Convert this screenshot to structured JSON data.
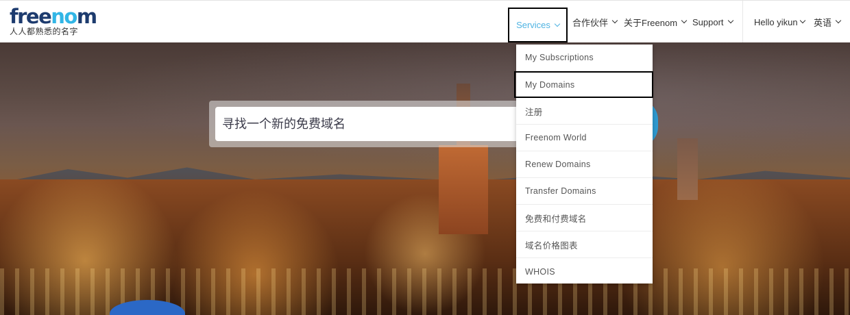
{
  "logo": {
    "brand_fre": "free",
    "brand_no": "no",
    "brand_m": "m",
    "tagline": "人人都熟悉的名字"
  },
  "nav": {
    "services": "Services",
    "partners": "合作伙伴",
    "about": "关于Freenom",
    "support": "Support",
    "user": "Hello yikun",
    "language": "英语"
  },
  "search": {
    "placeholder": "寻找一个新的免费域名"
  },
  "services_menu": {
    "items": [
      {
        "label": "My Subscriptions"
      },
      {
        "label": "My Domains"
      },
      {
        "label": "注册"
      },
      {
        "label": "Freenom World"
      },
      {
        "label": "Renew Domains"
      },
      {
        "label": "Transfer Domains"
      },
      {
        "label": "免费和付费域名"
      },
      {
        "label": "域名价格图表"
      },
      {
        "label": "WHOIS"
      }
    ]
  },
  "colors": {
    "accent": "#4fb3e2",
    "brand_dark": "#1d3b6e",
    "brand_light": "#32b6e6"
  }
}
